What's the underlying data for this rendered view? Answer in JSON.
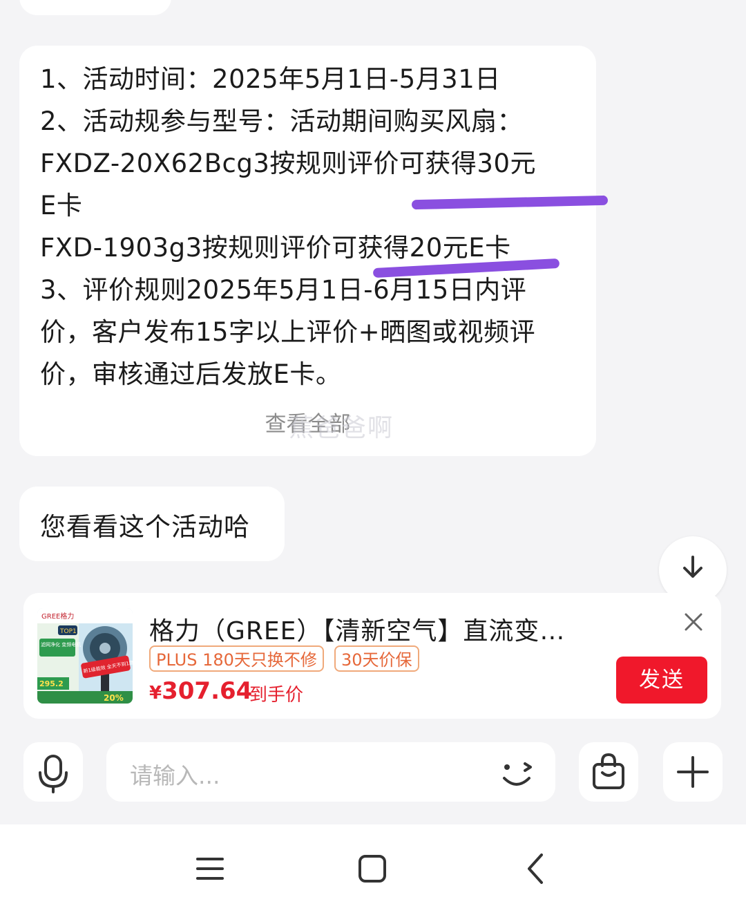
{
  "chat": {
    "message_lines": [
      "1、活动时间：2025年5月1日-5月31日",
      "2、活动规参与型号：活动期间购买风扇：",
      "FXDZ-20X62Bcg3按规则评价可获得30元",
      "E卡",
      "FXD-1903g3按规则评价可获得20元E卡",
      "3、评价规则2025年5月1日-6月15日内评",
      "价，客户发布15字以上评价+晒图或视频评",
      "价，审核通过后发放E卡。"
    ],
    "view_more": "查看全部",
    "watermark": "蕉爸爸啊",
    "reply_text": "您看看这个活动哈",
    "annotation_color": "#8a4fe0"
  },
  "product": {
    "title": "格力（GREE）【清新空气】直流变…",
    "tags": [
      "PLUS 180天只换不修",
      "30天价保"
    ],
    "price_symbol": "¥",
    "price": "307.64",
    "price_label": "到手价",
    "send_label": "发送",
    "thumb_texts": {
      "brand": "GREE格力",
      "top": "TOP1",
      "feature": "滤网净化 变频电机",
      "badge": "新1级能效 全天不到1度电",
      "price": "295.2",
      "percent": "20%"
    }
  },
  "input": {
    "placeholder": "请输入..."
  },
  "icons": {
    "mic": "microphone-icon",
    "emoji": "emoji-wink-icon",
    "bag": "shopping-bag-icon",
    "plus": "plus-icon",
    "close": "close-icon",
    "scroll": "arrow-down-icon",
    "nav_menu": "menu-icon",
    "nav_home": "home-square-icon",
    "nav_back": "back-chevron-icon"
  },
  "colors": {
    "send_button": "#f0182b",
    "price": "#e5202e",
    "tag_border": "#f0a97a",
    "tag_text": "#e6683a",
    "background": "#f4f4f6"
  }
}
